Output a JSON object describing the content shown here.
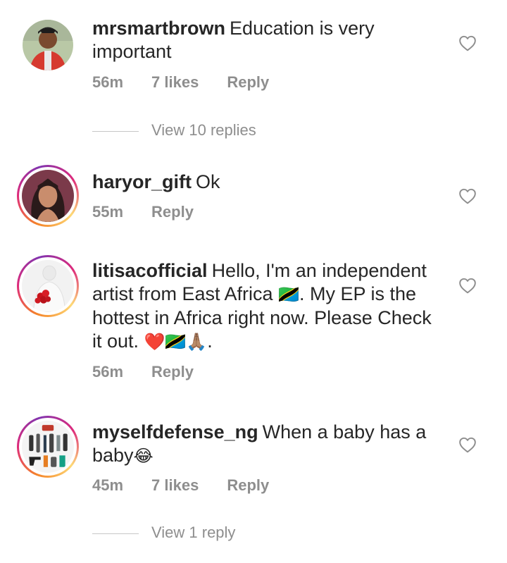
{
  "comments": [
    {
      "username": "mrsmartbrown",
      "text": "Education is very important",
      "time": "56m",
      "likes": "7 likes",
      "reply_label": "Reply",
      "view_replies": "View 10 replies"
    },
    {
      "username": "haryor_gift",
      "text": "Ok",
      "time": "55m",
      "reply_label": "Reply"
    },
    {
      "username": "litisacofficial",
      "text_part1": "Hello, I'm an independent artist from East Africa ",
      "flag1": "🇹🇿",
      "text_part2": ". My EP is the hottest in Africa right now. Please Check it out. ",
      "emojis": "❤️🇹🇿🙏🏽",
      "text_end": ".",
      "time": "56m",
      "reply_label": "Reply"
    },
    {
      "username": "myselfdefense_ng",
      "text": "When a baby has a baby",
      "emoji": "😂",
      "time": "45m",
      "likes": "7 likes",
      "reply_label": "Reply",
      "view_replies": "View 1 reply"
    }
  ],
  "icons": {
    "like": "heart-outline-icon"
  },
  "colors": {
    "text": "#262626",
    "meta": "#8e8e8e",
    "divider": "#c7c7c7"
  }
}
